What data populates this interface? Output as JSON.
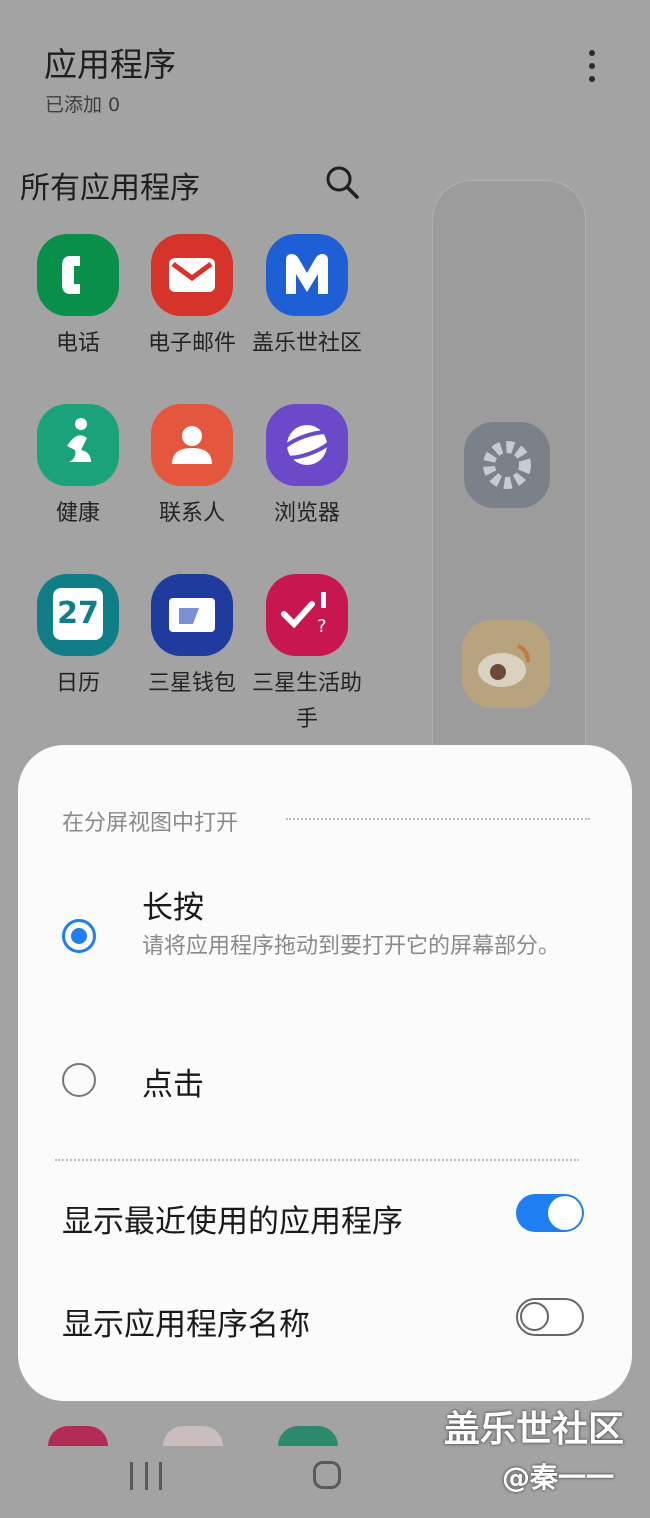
{
  "header": {
    "title": "应用程序",
    "subtitle": "已添加 0"
  },
  "all_apps": {
    "title": "所有应用程序",
    "apps": [
      {
        "label": "电话",
        "icon": "phone-icon",
        "color": "#08904a"
      },
      {
        "label": "电子邮件",
        "icon": "email-icon",
        "color": "#d6332a"
      },
      {
        "label": "盖乐世社区",
        "icon": "galaxy-members-icon",
        "color": "#1f5fd6"
      },
      {
        "label": "健康",
        "icon": "health-icon",
        "color": "#1aa37a"
      },
      {
        "label": "联系人",
        "icon": "contacts-icon",
        "color": "#e4563d"
      },
      {
        "label": "浏览器",
        "icon": "browser-icon",
        "color": "#6b49c9"
      },
      {
        "label": "日历",
        "icon": "calendar-icon",
        "color": "#0f7e86"
      },
      {
        "label": "三星钱包",
        "icon": "wallet-icon",
        "color": "#1f3b9e"
      },
      {
        "label": "三星生活助手",
        "icon": "life-assistant-icon",
        "color": "#c8174f"
      }
    ],
    "calendar_day": "27"
  },
  "edge_panel": {
    "items": [
      "settings-icon",
      "weibo-icon"
    ]
  },
  "dialog": {
    "section_title": "在分屏视图中打开",
    "option_long_press": {
      "label": "长按",
      "description": "请将应用程序拖动到要打开它的屏幕部分。",
      "selected": true
    },
    "option_tap": {
      "label": "点击",
      "selected": false
    },
    "show_recent": {
      "label": "显示最近使用的应用程序",
      "enabled": true
    },
    "show_names": {
      "label": "显示应用程序名称",
      "enabled": false
    }
  },
  "watermark": {
    "line1": "盖乐世社区",
    "line2": "@秦一一"
  },
  "colors": {
    "accent": "#1f7ef2"
  }
}
